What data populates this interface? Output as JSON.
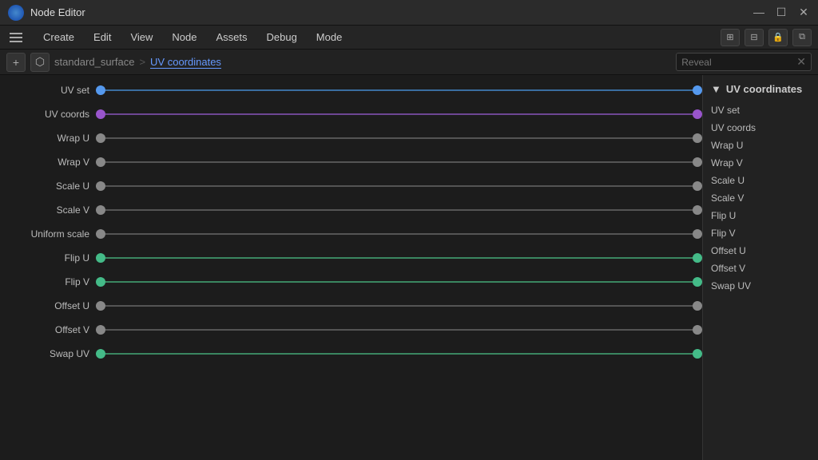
{
  "titlebar": {
    "title": "Node Editor",
    "minimize": "—",
    "maximize": "☐",
    "close": "✕"
  },
  "menubar": {
    "items": [
      "Create",
      "Edit",
      "View",
      "Node",
      "Assets",
      "Debug",
      "Mode"
    ]
  },
  "toolbar": {
    "add_label": "+",
    "breadcrumb_root": "standard_surface",
    "breadcrumb_sep": ">",
    "breadcrumb_current": "UV coordinates",
    "search_placeholder": "Reveal"
  },
  "right_panel": {
    "title": "UV coordinates",
    "expand": "▼",
    "rows": [
      "UV set",
      "UV coords",
      "Wrap U",
      "Wrap V",
      "Scale U",
      "Scale V",
      "Flip U",
      "Flip V",
      "Offset U",
      "Offset V",
      "Swap UV"
    ]
  },
  "node_rows": [
    {
      "label": "UV set",
      "dot_color": "blue",
      "line_color": "#4488cc",
      "right_dot": "blue"
    },
    {
      "label": "UV coords",
      "dot_color": "purple",
      "line_color": "#8855bb",
      "right_dot": "purple"
    },
    {
      "label": "Wrap U",
      "dot_color": "gray",
      "line_color": "#666666",
      "right_dot": "gray"
    },
    {
      "label": "Wrap V",
      "dot_color": "gray",
      "line_color": "#666666",
      "right_dot": "gray"
    },
    {
      "label": "Scale U",
      "dot_color": "gray",
      "line_color": "#777777",
      "right_dot": "gray"
    },
    {
      "label": "Scale V",
      "dot_color": "gray",
      "line_color": "#777777",
      "right_dot": "gray"
    },
    {
      "label": "Uniform scale",
      "dot_color": "gray",
      "line_color": "#666666",
      "right_dot": "gray"
    },
    {
      "label": "Flip U",
      "dot_color": "green",
      "line_color": "#44aa77",
      "right_dot": "green"
    },
    {
      "label": "Flip V",
      "dot_color": "green",
      "line_color": "#44aa77",
      "right_dot": "green"
    },
    {
      "label": "Offset U",
      "dot_color": "gray",
      "line_color": "#666666",
      "right_dot": "gray"
    },
    {
      "label": "Offset V",
      "dot_color": "gray",
      "line_color": "#666666",
      "right_dot": "gray"
    },
    {
      "label": "Swap UV",
      "dot_color": "green",
      "line_color": "#44aa77",
      "right_dot": "green"
    }
  ],
  "colors": {
    "blue": "#5599ee",
    "purple": "#9955cc",
    "gray": "#888888",
    "green": "#44bb88"
  }
}
